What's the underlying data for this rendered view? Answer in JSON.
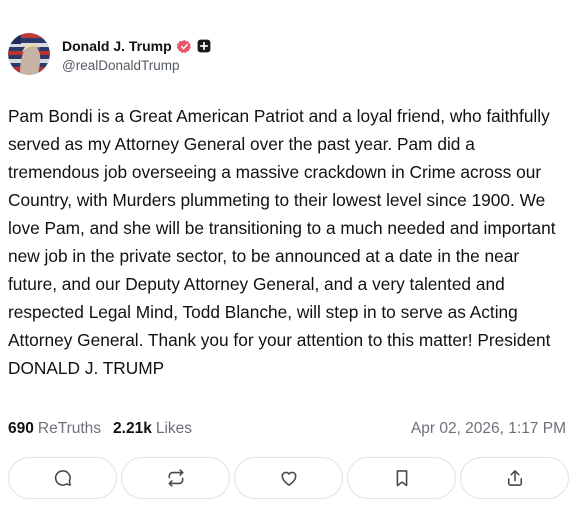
{
  "author": {
    "display_name": "Donald J. Trump",
    "handle": "@realDonaldTrump",
    "avatar_icon": "flag-portrait-avatar",
    "verified_color": "#e8566a"
  },
  "post": {
    "text": "Pam Bondi is a Great American Patriot and a loyal friend, who faithfully served as my Attorney General over the past year. Pam did a tremendous job overseeing a massive crackdown in Crime across our Country, with Murders plummeting to their lowest level since 1900. We love Pam, and she will be transitioning to a much needed and important new job in the private sector, to be announced at a date in the near future, and our Deputy Attorney General, and a very talented and respected Legal Mind, Todd Blanche, will step in to serve as Acting Attorney General. Thank you for your attention to this matter! President DONALD J. TRUMP"
  },
  "stats": {
    "retruths_count": "690",
    "retruths_label": "ReTruths",
    "likes_count": "2.21k",
    "likes_label": "Likes",
    "timestamp": "Apr 02, 2026, 1:17 PM"
  },
  "actions": [
    {
      "icon": "reply-icon"
    },
    {
      "icon": "retruth-icon"
    },
    {
      "icon": "like-icon"
    },
    {
      "icon": "bookmark-icon"
    },
    {
      "icon": "share-icon"
    }
  ]
}
